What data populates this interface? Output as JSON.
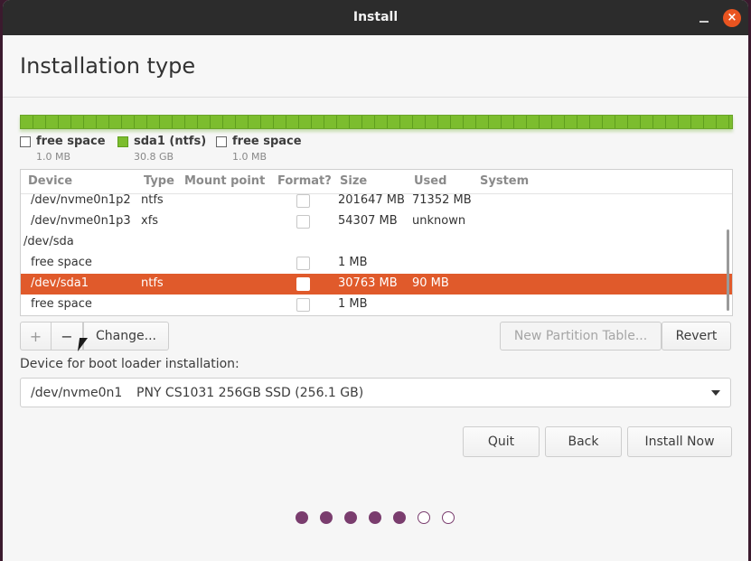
{
  "window": {
    "title": "Install",
    "close_glyph": "×"
  },
  "header": {
    "title": "Installation type"
  },
  "legend": [
    {
      "name": "free space",
      "size": "1.0 MB",
      "color": "#ffffff"
    },
    {
      "name": "sda1 (ntfs)",
      "size": "30.8 GB",
      "color": "#7cbd2e"
    },
    {
      "name": "free space",
      "size": "1.0 MB",
      "color": "#ffffff"
    }
  ],
  "table": {
    "columns": [
      "Device",
      "Type",
      "Mount point",
      "Format?",
      "Size",
      "Used",
      "System"
    ],
    "rows": [
      {
        "device": "/dev/nvme0n1p2",
        "type": "ntfs",
        "mount": "",
        "format": true,
        "size": "201647 MB",
        "used": "71352 MB",
        "system": ""
      },
      {
        "device": "/dev/nvme0n1p3",
        "type": "xfs",
        "mount": "",
        "format": true,
        "size": "54307 MB",
        "used": "unknown",
        "system": ""
      },
      {
        "device": "/dev/sda",
        "type": "",
        "mount": "",
        "format": false,
        "size": "",
        "used": "",
        "system": ""
      },
      {
        "device": "free space",
        "type": "",
        "mount": "",
        "format": true,
        "size": "1 MB",
        "used": "",
        "system": ""
      },
      {
        "device": "/dev/sda1",
        "type": "ntfs",
        "mount": "",
        "format": true,
        "size": "30763 MB",
        "used": "90 MB",
        "system": ""
      },
      {
        "device": "free space",
        "type": "",
        "mount": "",
        "format": true,
        "size": "1 MB",
        "used": "",
        "system": ""
      }
    ]
  },
  "partition_buttons": {
    "add": "+",
    "remove": "−",
    "change": "Change...",
    "new_table": "New Partition Table...",
    "revert": "Revert"
  },
  "boot_loader": {
    "label": "Device for boot loader installation:",
    "device": "/dev/nvme0n1",
    "model": "PNY CS1031 256GB SSD (256.1 GB)"
  },
  "footer": {
    "quit": "Quit",
    "back": "Back",
    "install_now": "Install Now"
  },
  "progress": {
    "steps_total": 7,
    "steps_done": 5,
    "accent": "#7a3d6e"
  },
  "colors": {
    "selection": "#e05a2b",
    "disk_bar": "#7cbd2e",
    "close": "#e95420"
  }
}
